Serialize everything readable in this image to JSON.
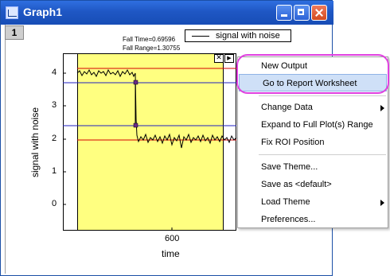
{
  "window": {
    "title": "Graph1",
    "layer_tab": "1"
  },
  "plot": {
    "y_axis_title": "signal with noise",
    "x_axis_title": "time",
    "y_ticks": [
      "4",
      "3",
      "2",
      "1",
      "0"
    ],
    "x_ticks": [
      "600"
    ],
    "fall_time_label": "Fall Time=0.69596",
    "fall_range_label": "Fall Range=1.30755",
    "legend_label": "signal with noise",
    "roi_close_glyph": "✕",
    "roi_arrow_glyph": "▶",
    "colors": {
      "roi_fill": "#ffff80",
      "high_low_lines": "#d40000",
      "threshold_lines": "#2020c0",
      "signal": "#000000",
      "marker": "#6a2a8a"
    }
  },
  "menu": {
    "items": [
      {
        "label": "New Output",
        "submenu": false
      },
      {
        "label": "Go to Report Worksheet",
        "submenu": false,
        "highlighted": true
      },
      {
        "label": "Change Data",
        "submenu": true
      },
      {
        "label": "Expand to Full Plot(s) Range",
        "submenu": false
      },
      {
        "label": "Fix ROI Position",
        "submenu": false
      },
      {
        "label": "Save Theme...",
        "submenu": false
      },
      {
        "label": "Save as <default>",
        "submenu": false
      },
      {
        "label": "Load Theme",
        "submenu": true
      },
      {
        "label": "Preferences...",
        "submenu": false
      }
    ],
    "highlight_color": "#e040e0"
  }
}
